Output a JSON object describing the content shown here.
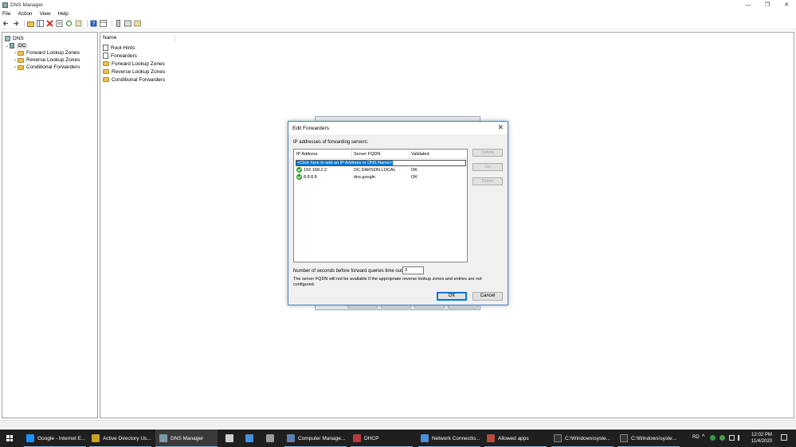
{
  "window": {
    "title": "DNS Manager",
    "minimize": "—",
    "restore": "❐",
    "close": "✕"
  },
  "menu": [
    "File",
    "Action",
    "View",
    "Help"
  ],
  "tree": {
    "root": "DNS",
    "server": "DC",
    "children": [
      "Forward Lookup Zones",
      "Reverse Lookup Zones",
      "Conditional Forwarders"
    ]
  },
  "list": {
    "column": "Name",
    "items": [
      "Root Hints",
      "Forwarders",
      "Forward Lookup Zones",
      "Reverse Lookup Zones",
      "Conditional Forwarders"
    ]
  },
  "dialog": {
    "title": "Edit Forwarders",
    "close": "✕",
    "list_label": "IP addresses of forwarding servers:",
    "columns": [
      "IP Address",
      "Server FQDN",
      "Validated"
    ],
    "add_placeholder": "<Click here to add an IP Address or DNS Name>",
    "rows": [
      {
        "ip": "192.168.2.2",
        "fqdn": "DC.DARSON.LOCAL",
        "validated": "OK"
      },
      {
        "ip": "8.8.8.8",
        "fqdn": "dns.google",
        "validated": "OK"
      }
    ],
    "side_buttons": {
      "delete": "Delete",
      "up": "Up",
      "down": "Down"
    },
    "timeout_label": "Number of seconds before forward queries time out:",
    "timeout_value": "3",
    "note": "The server FQDN will not be available if the appropriate reverse lookup zones and entries are not configured.",
    "ok": "OK",
    "cancel": "Cancel"
  },
  "taskbar": {
    "apps": [
      {
        "label": "Google - Internet E...",
        "color": "#1e90ff"
      },
      {
        "label": "Active Directory Us...",
        "color": "#c9a227"
      },
      {
        "label": "DNS Manager",
        "color": "#7a9aa8"
      },
      {
        "label": "",
        "color": "#cfcfcf"
      },
      {
        "label": "",
        "color": "#4a90d9"
      },
      {
        "label": "",
        "color": "#9a9a9a"
      },
      {
        "label": "Computer Manage...",
        "color": "#5b7fb5"
      },
      {
        "label": "DHCP",
        "color": "#b73a3a"
      },
      {
        "label": "Network Connectio...",
        "color": "#4a90d9"
      },
      {
        "label": "Allowed apps",
        "color": "#b34b3b"
      },
      {
        "label": "C:\\Windows\\syste...",
        "color": "#333333"
      },
      {
        "label": "C:\\Windows\\syste...",
        "color": "#333333"
      }
    ],
    "tray_text": "RD",
    "time": "12:02 PM",
    "date": "11/4/2020"
  }
}
